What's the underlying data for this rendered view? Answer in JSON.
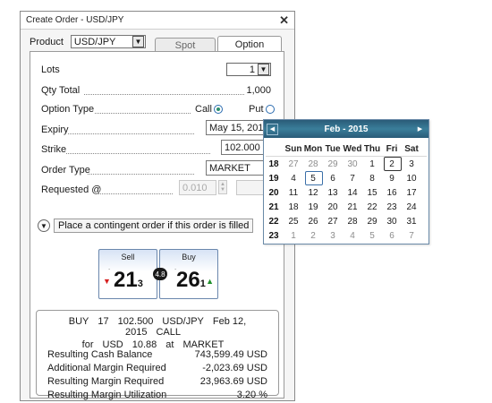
{
  "window": {
    "title": "Create Order - USD/JPY",
    "close_glyph": "✕"
  },
  "product": {
    "label": "Product",
    "value": "USD/JPY"
  },
  "tabs": [
    {
      "label": "Spot"
    },
    {
      "label": "Option"
    }
  ],
  "form": {
    "lots_label": "Lots",
    "lots_value": "1",
    "qty_label": "Qty Total",
    "qty_value": "1,000",
    "option_type_label": "Option Type",
    "call_label": "Call",
    "put_label": "Put",
    "expiry_label": "Expiry",
    "expiry_value": "May 15, 201",
    "strike_label": "Strike",
    "strike_value": "102.000",
    "order_type_label": "Order Type",
    "order_type_value": "MARKET",
    "requested_label": "Requested @",
    "requested_value": "0.010"
  },
  "contingent": {
    "label": "Place a contingent order if this order is filled"
  },
  "prices": {
    "sell": {
      "label": "Sell",
      "big": "21",
      "small": "3"
    },
    "spread": "4.8",
    "buy": {
      "label": "Buy",
      "big": "26",
      "small": "1"
    }
  },
  "summary": {
    "line1": [
      "BUY",
      "17",
      "102.500",
      "USD/JPY",
      "Feb 12, 2015",
      "CALL"
    ],
    "line2": [
      "for",
      "USD",
      "10.88",
      "at",
      "MARKET"
    ],
    "rows": [
      {
        "label": "Resulting Cash Balance",
        "value": "743,599.49",
        "unit": "USD"
      },
      {
        "label": "Additional Margin Required",
        "value": "-2,023.69",
        "unit": "USD"
      },
      {
        "label": "Resulting Margin Required",
        "value": "23,963.69",
        "unit": "USD"
      },
      {
        "label": "Resulting Margin Utilization",
        "value": "3.20",
        "unit": "%"
      }
    ]
  },
  "calendar": {
    "month": "Feb - 2015",
    "days": [
      "Sun",
      "Mon",
      "Tue",
      "Wed",
      "Thu",
      "Fri",
      "Sat"
    ],
    "weeks": [
      {
        "wk": "18",
        "d": [
          "27",
          "28",
          "29",
          "30",
          "1",
          "2",
          "3"
        ]
      },
      {
        "wk": "19",
        "d": [
          "4",
          "5",
          "6",
          "7",
          "8",
          "9",
          "10"
        ]
      },
      {
        "wk": "20",
        "d": [
          "11",
          "12",
          "13",
          "14",
          "15",
          "16",
          "17"
        ]
      },
      {
        "wk": "21",
        "d": [
          "18",
          "19",
          "20",
          "21",
          "22",
          "23",
          "24"
        ]
      },
      {
        "wk": "22",
        "d": [
          "25",
          "26",
          "27",
          "28",
          "29",
          "30",
          "31"
        ]
      },
      {
        "wk": "23",
        "d": [
          "1",
          "2",
          "3",
          "4",
          "5",
          "6",
          "7"
        ]
      }
    ]
  },
  "colors": {
    "header": "#2a5b78",
    "down": "#d61f1f",
    "up": "#1e8f2a"
  }
}
